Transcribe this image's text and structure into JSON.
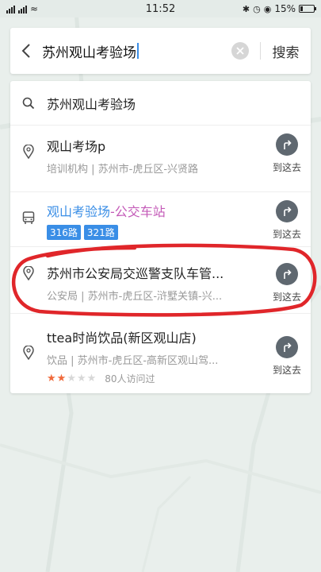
{
  "status_bar": {
    "left_text": "4G",
    "time": "11:52",
    "battery": "15%"
  },
  "search": {
    "query": "苏州观山考验场",
    "button_label": "搜索"
  },
  "suggestion": {
    "text": "苏州观山考验场"
  },
  "results": [
    {
      "title": "观山考场p",
      "subtitle": "培训机构 | 苏州市-虎丘区-兴贤路",
      "go_label": "到这去"
    },
    {
      "title_main": "观山考验场",
      "title_suffix": "-公交车站",
      "lines": [
        "316路",
        "321路"
      ],
      "go_label": "到这去"
    },
    {
      "title": "苏州市公安局交巡警支队车管...",
      "subtitle": "公安局 | 苏州市-虎丘区-浒墅关镇-兴...",
      "go_label": "到这去"
    },
    {
      "title": "ttea时尚饮品(新区观山店)",
      "subtitle": "饮品 | 苏州市-虎丘区-高新区观山驾...",
      "rating": 2,
      "rating_max": 5,
      "visits": "80人访问过",
      "go_label": "到这去"
    }
  ],
  "colors": {
    "accent_blue": "#3a8ee6",
    "accent_pink": "#c45bb8",
    "annotation_red": "#e0262a",
    "star_orange": "#f06a3c"
  }
}
